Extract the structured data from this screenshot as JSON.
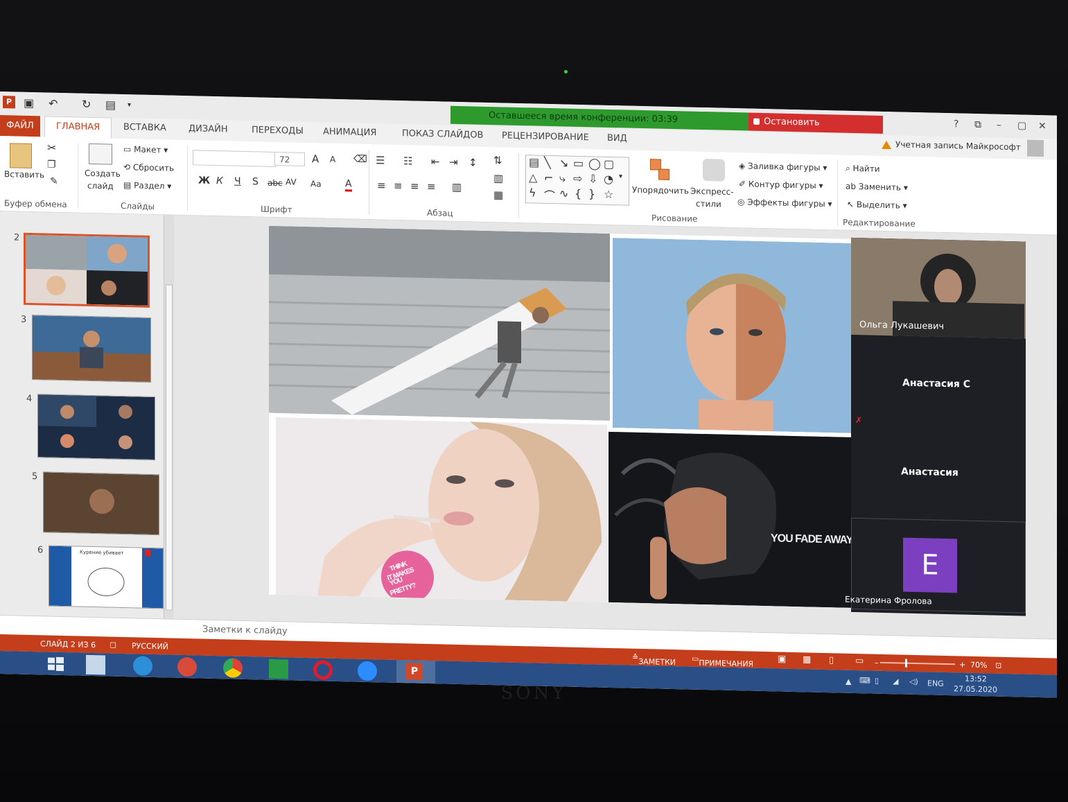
{
  "window": {
    "conference_timer": "Оставшееся время конференции: 03:39",
    "stop_demo_label": "Остановить демонстрацию",
    "account_label": "Учетная запись Майкрософт",
    "help": "?",
    "minimize": "–",
    "maximize": "▢",
    "close": "✕"
  },
  "tabs": [
    {
      "label": "ФАЙЛ"
    },
    {
      "label": "ГЛАВНАЯ"
    },
    {
      "label": "ВСТАВКА"
    },
    {
      "label": "ДИЗАЙН"
    },
    {
      "label": "ПЕРЕХОДЫ"
    },
    {
      "label": "АНИМАЦИЯ"
    },
    {
      "label": "ПОКАЗ СЛАЙДОВ"
    },
    {
      "label": "РЕЦЕНЗИРОВАНИЕ"
    },
    {
      "label": "ВИД"
    }
  ],
  "ribbon": {
    "clipboard": {
      "paste": "Вставить",
      "group": "Буфер обмена"
    },
    "slides": {
      "new_slide_1": "Создать",
      "new_slide_2": "слайд",
      "layout": "Макет",
      "reset": "Сбросить",
      "section": "Раздел",
      "group": "Слайды"
    },
    "font": {
      "size": "72",
      "bold": "Ж",
      "italic": "К",
      "underline": "Ч",
      "shadow": "S",
      "strike": "abc",
      "spacing": "AV",
      "case": "Aa",
      "color": "A",
      "grow": "A",
      "shrink": "A",
      "group": "Шрифт"
    },
    "paragraph": {
      "group": "Абзац"
    },
    "drawing": {
      "arrange": "Упорядочить",
      "quick_styles_1": "Экспресс-",
      "quick_styles_2": "стили",
      "fill": "Заливка фигуры",
      "outline": "Контур фигуры",
      "effects": "Эффекты фигуры",
      "group": "Рисование"
    },
    "editing": {
      "find": "Найти",
      "replace": "Заменить",
      "select": "Выделить",
      "group": "Редактирование"
    }
  },
  "thumbnails": [
    {
      "num": "2"
    },
    {
      "num": "3"
    },
    {
      "num": "4"
    },
    {
      "num": "5"
    },
    {
      "num": "6",
      "text": "Курение убивает"
    }
  ],
  "slide": {
    "caption_fade": "YOU FADE AWAY",
    "badge_1": "THINK",
    "badge_2": "IT MAKES",
    "badge_3": "YOU",
    "badge_4": "PRETTY?"
  },
  "participants": [
    {
      "name": "Ольга Лукашевич"
    },
    {
      "name": "Анастасия С"
    },
    {
      "name": "Анастасия"
    },
    {
      "name": "Екатерина Фролова",
      "initial": "E"
    }
  ],
  "notes_placeholder": "Заметки к слайду",
  "status": {
    "slide_info": "СЛАЙД 2 ИЗ 6",
    "language": "РУССКИЙ",
    "notes": "ЗАМЕТКИ",
    "comments": "ПРИМЕЧАНИЯ",
    "zoom": "70%",
    "minus": "–",
    "plus": "+"
  },
  "taskbar": {
    "lang": "ENG",
    "time": "13:52",
    "date": "27.05.2020"
  },
  "hardware": {
    "brand": "SONY"
  },
  "colors": {
    "accent": "#c43e1c",
    "conference": "#2e9a2e",
    "stop": "#d32f2f",
    "taskbar": "#2a4f86",
    "avatar": "#7b3fbf"
  }
}
